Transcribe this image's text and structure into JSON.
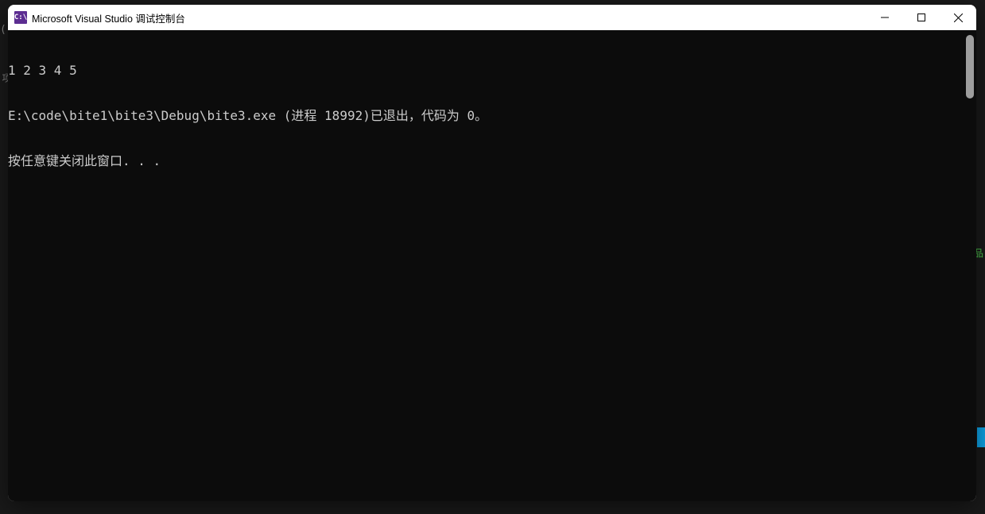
{
  "background": {
    "left_fragment1": "(",
    "left_fragment2": "项",
    "right_green": "品",
    "right_blue_accent": "#0ea5e9"
  },
  "window": {
    "title_icon_text": "C:\\",
    "title": "Microsoft Visual Studio 调试控制台"
  },
  "console": {
    "lines": [
      "1 2 3 4 5",
      "E:\\code\\bite1\\bite3\\Debug\\bite3.exe (进程 18992)已退出，代码为 0。",
      "按任意键关闭此窗口. . ."
    ]
  },
  "colors": {
    "titlebar_bg": "#ffffff",
    "console_bg": "#0c0c0c",
    "console_fg": "#cccccc",
    "vs_purple": "#5c2d91"
  }
}
